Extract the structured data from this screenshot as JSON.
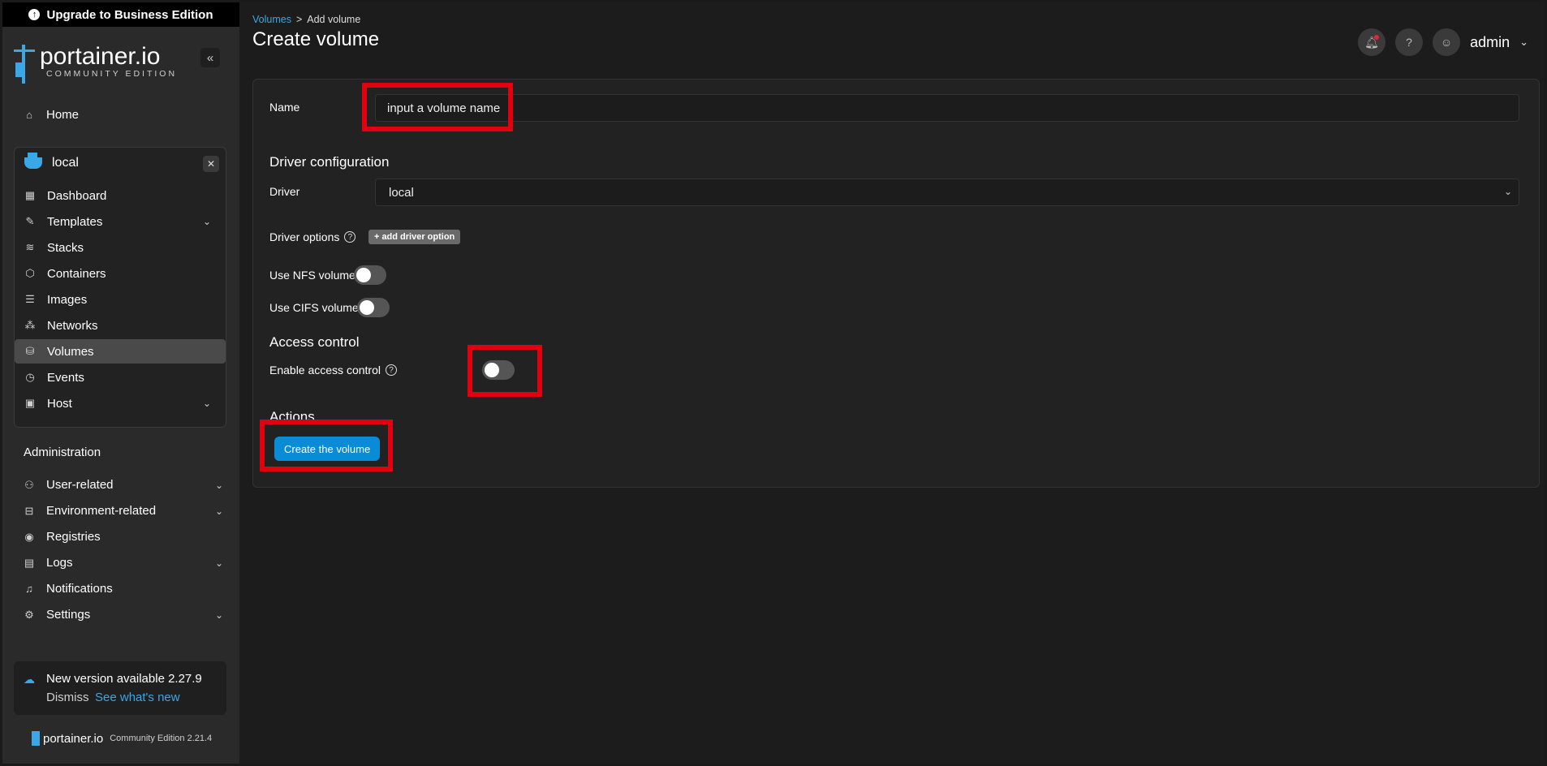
{
  "banner": {
    "upgrade_label": "Upgrade to Business Edition"
  },
  "logo": {
    "brand": "portainer.io",
    "edition": "COMMUNITY EDITION"
  },
  "sidebar": {
    "home_label": "Home",
    "environment": {
      "name": "local",
      "items": [
        {
          "label": "Dashboard"
        },
        {
          "label": "Templates"
        },
        {
          "label": "Stacks"
        },
        {
          "label": "Containers"
        },
        {
          "label": "Images"
        },
        {
          "label": "Networks"
        },
        {
          "label": "Volumes"
        },
        {
          "label": "Events"
        },
        {
          "label": "Host"
        }
      ]
    },
    "administration_title": "Administration",
    "admin_items": [
      {
        "label": "User-related"
      },
      {
        "label": "Environment-related"
      },
      {
        "label": "Registries"
      },
      {
        "label": "Logs"
      },
      {
        "label": "Notifications"
      },
      {
        "label": "Settings"
      }
    ],
    "update": {
      "message": "New version available 2.27.9",
      "dismiss": "Dismiss",
      "link": "See what's new"
    },
    "footer": {
      "brand": "portainer.io",
      "version": "Community Edition  2.21.4"
    }
  },
  "breadcrumb": {
    "link": "Volumes",
    "separator": ">",
    "current": "Add volume"
  },
  "header": {
    "title": "Create volume",
    "user": "admin"
  },
  "form": {
    "name_label": "Name",
    "name_value": "input a volume name",
    "driver_section": "Driver configuration",
    "driver_label": "Driver",
    "driver_value": "local",
    "driver_options_label": "Driver options",
    "add_driver_option": "add driver option",
    "nfs_label": "Use NFS volume",
    "cifs_label": "Use CIFS volume",
    "access_section": "Access control",
    "access_label": "Enable access control",
    "actions_section": "Actions",
    "create_button": "Create the volume"
  },
  "colors": {
    "accent": "#0a8bd6",
    "link": "#3aa7e6",
    "highlight": "#e0000f"
  }
}
